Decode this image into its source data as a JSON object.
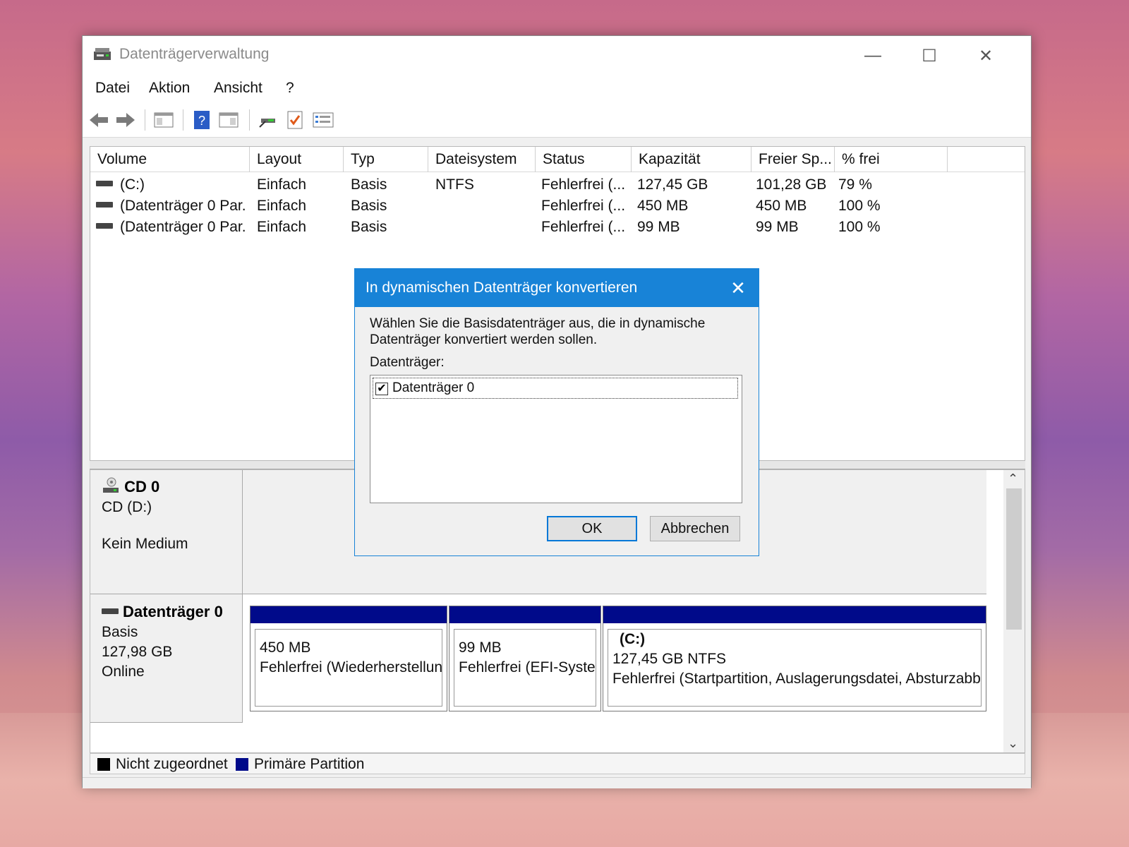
{
  "window": {
    "title": "Datenträgerverwaltung",
    "minimize": "—",
    "maximize": "☐",
    "close": "✕"
  },
  "menu": [
    "Datei",
    "Aktion",
    "Ansicht",
    "?"
  ],
  "toolbar": {
    "icons": [
      "back-arrow-icon",
      "forward-arrow-icon",
      "console-tree-icon",
      "help-icon",
      "properties-icon",
      "connect-icon",
      "check-icon",
      "list-settings-icon"
    ]
  },
  "volume_table": {
    "headers": [
      "Volume",
      "Layout",
      "Typ",
      "Dateisystem",
      "Status",
      "Kapazität",
      "Freier Sp...",
      "% frei"
    ],
    "rows": [
      [
        "(C:)",
        "Einfach",
        "Basis",
        "NTFS",
        "Fehlerfrei (...",
        "127,45 GB",
        "101,28 GB",
        "79 %"
      ],
      [
        "(Datenträger 0 Par...",
        "Einfach",
        "Basis",
        "",
        "Fehlerfrei (...",
        "450 MB",
        "450 MB",
        "100 %"
      ],
      [
        "(Datenträger 0 Par...",
        "Einfach",
        "Basis",
        "",
        "Fehlerfrei (...",
        "99 MB",
        "99 MB",
        "100 %"
      ]
    ]
  },
  "cd": {
    "name": "CD 0",
    "drive": "CD (D:)",
    "media": "Kein Medium"
  },
  "disk0": {
    "name": "Datenträger 0",
    "type": "Basis",
    "size": "127,98 GB",
    "state": "Online",
    "partitions": [
      {
        "title": "",
        "size": "450 MB",
        "status": "Fehlerfrei (Wiederherstellun"
      },
      {
        "title": "",
        "size": "99 MB",
        "status": "Fehlerfrei (EFI-Syster"
      },
      {
        "title": "(C:)",
        "size": "127,45 GB NTFS",
        "status": "Fehlerfrei (Startpartition, Auslagerungsdatei, Absturzabbi"
      }
    ]
  },
  "legend": [
    {
      "label": "Nicht zugeordnet",
      "color": "#000000"
    },
    {
      "label": "Primäre Partition",
      "color": "#000a8a"
    }
  ],
  "dialog": {
    "title": "In dynamischen Datenträger konvertieren",
    "message": "Wählen Sie die Basisdatenträger aus, die in dynamische Datenträger konvertiert werden sollen.",
    "list_label": "Datenträger:",
    "items": [
      {
        "label": "Datenträger 0",
        "checked": true
      }
    ],
    "ok": "OK",
    "cancel": "Abbrechen"
  },
  "colors": {
    "accent": "#1883d7",
    "partition_header": "#000a8a"
  }
}
